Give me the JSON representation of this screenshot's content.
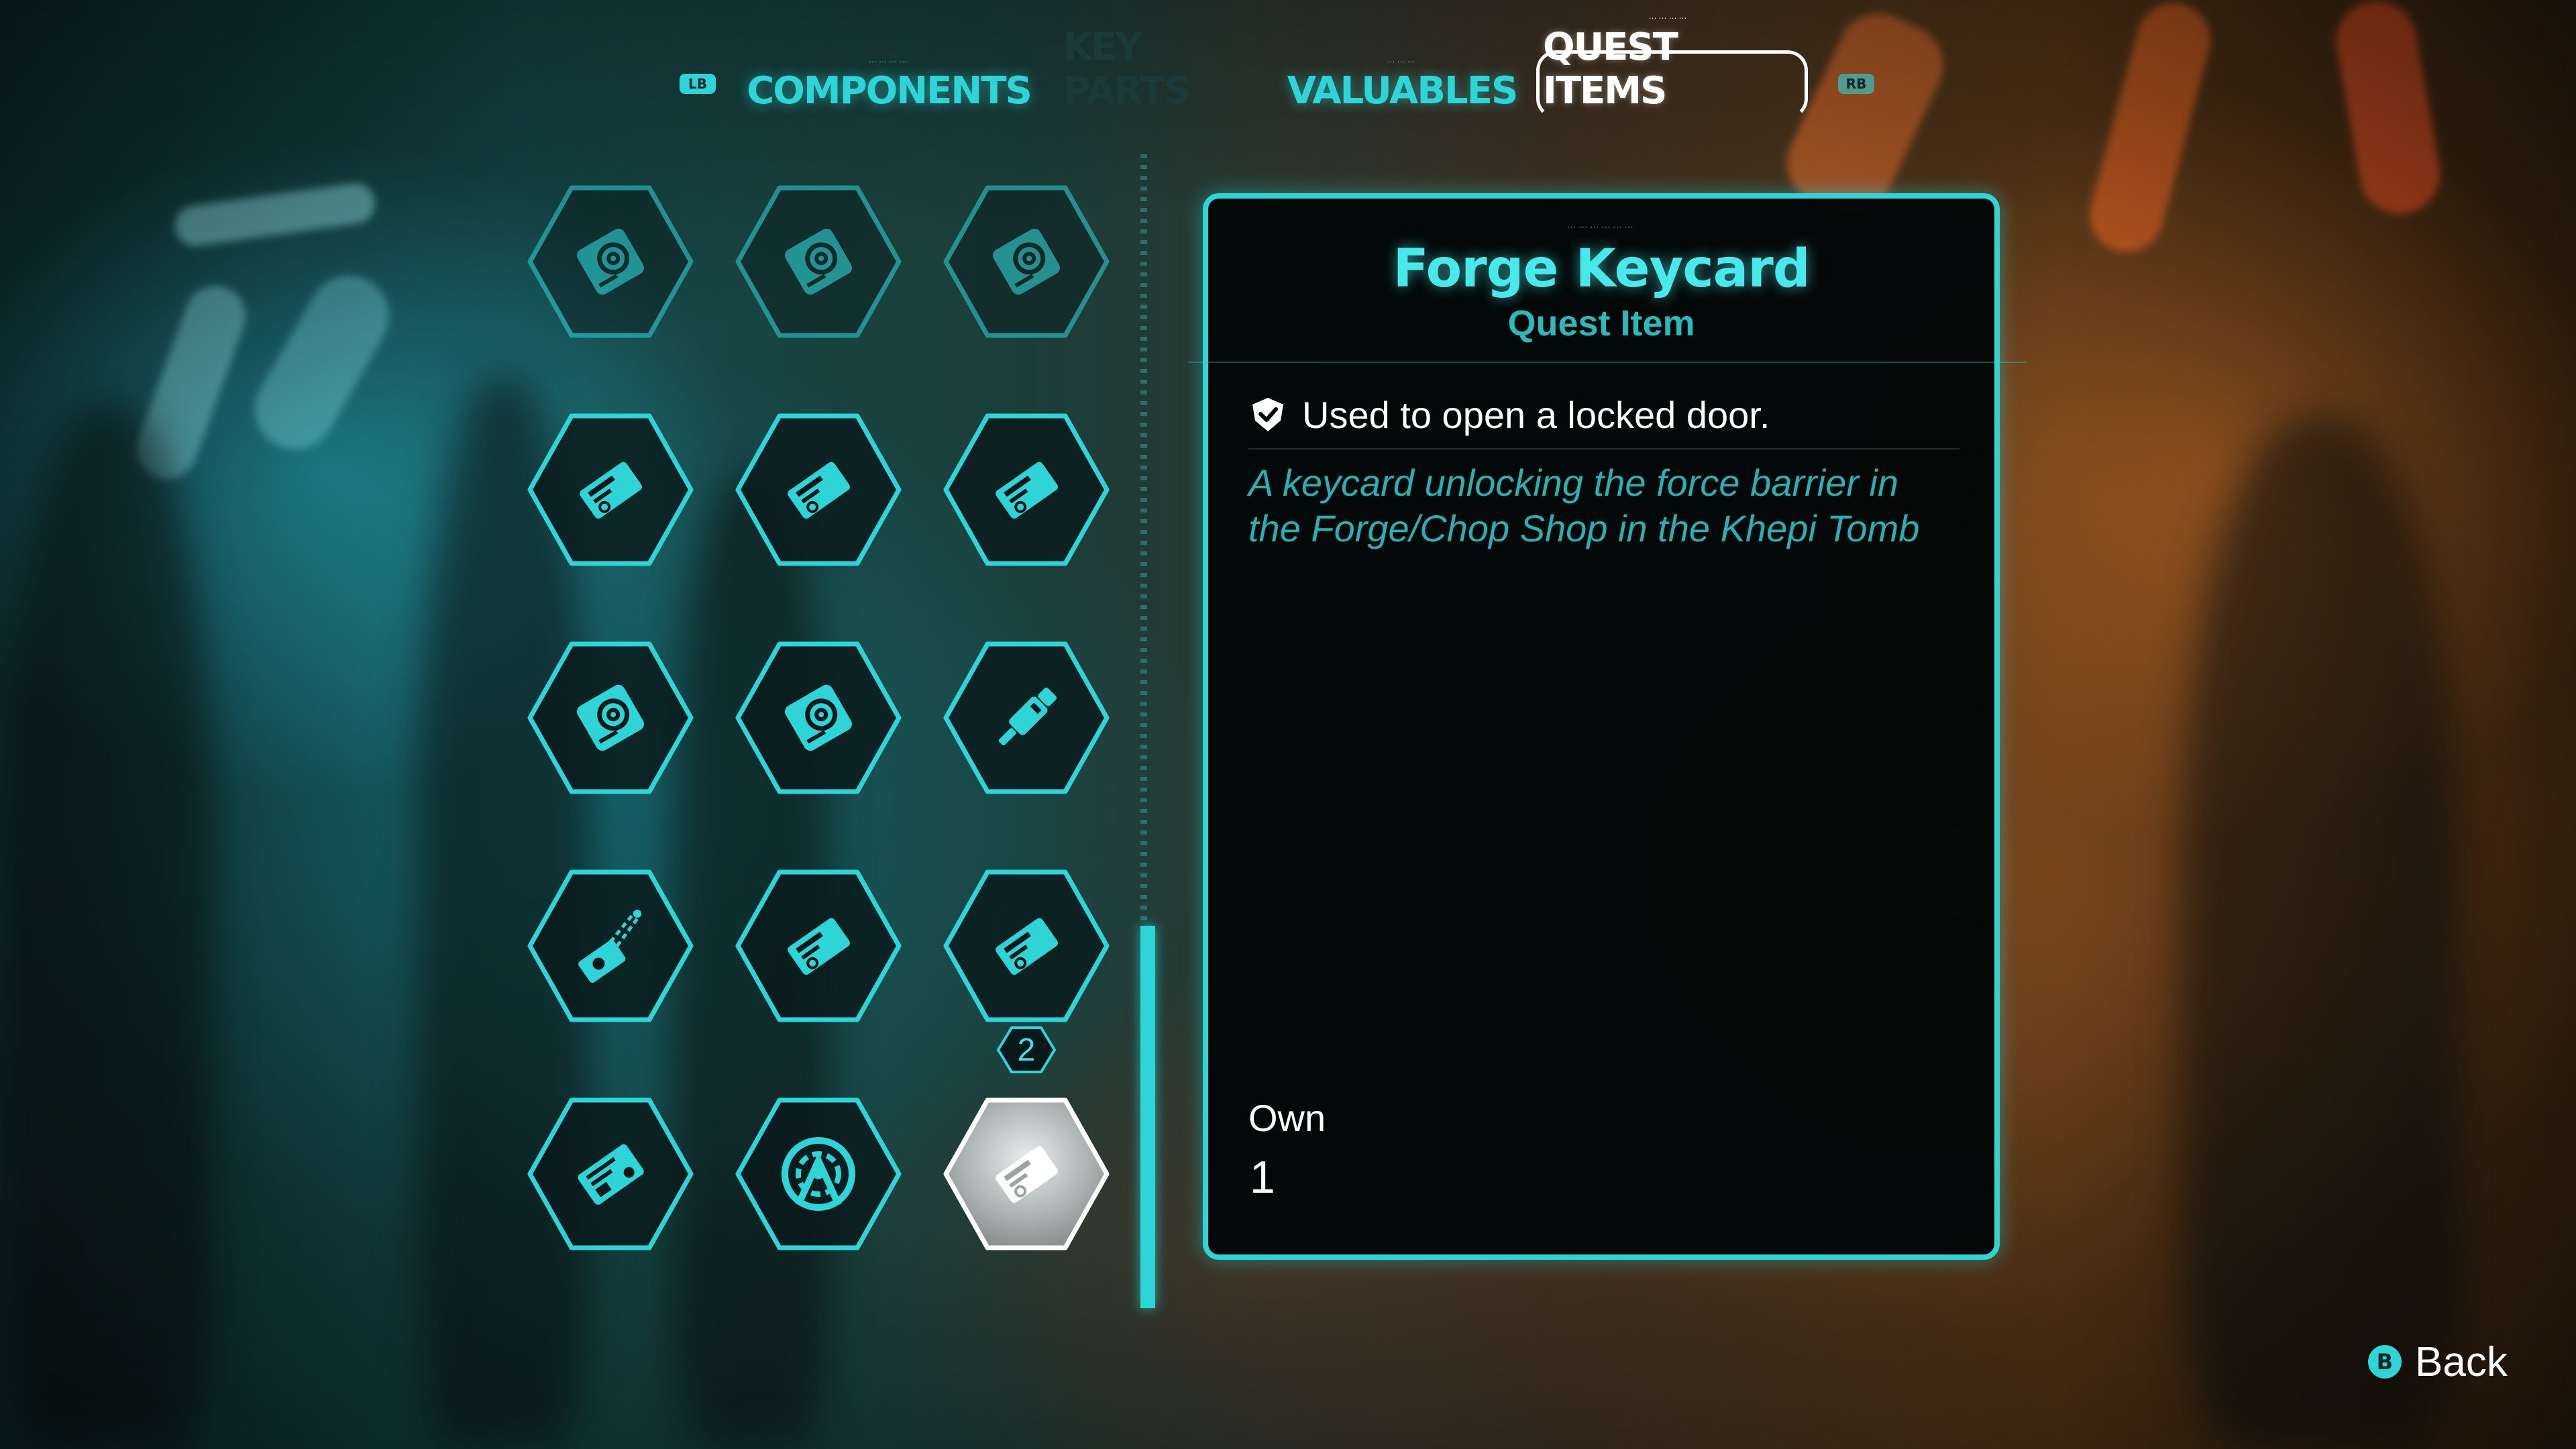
{
  "tabs": {
    "left_bumper": "LB",
    "right_bumper": "RB",
    "items": [
      {
        "label": "COMPONENTS",
        "state": "normal"
      },
      {
        "label": "KEY PARTS",
        "state": "dim"
      },
      {
        "label": "VALUABLES",
        "state": "normal"
      },
      {
        "label": "QUEST ITEMS",
        "state": "active"
      }
    ]
  },
  "grid": {
    "slots": [
      {
        "icon": "hard-drive-icon",
        "state": "faded"
      },
      {
        "icon": "hard-drive-icon",
        "state": "faded"
      },
      {
        "icon": "hard-drive-icon",
        "state": "faded"
      },
      {
        "icon": "keycard-icon",
        "state": "normal"
      },
      {
        "icon": "keycard-icon",
        "state": "normal"
      },
      {
        "icon": "keycard-icon",
        "state": "normal"
      },
      {
        "icon": "hard-drive-icon",
        "state": "normal"
      },
      {
        "icon": "hard-drive-icon",
        "state": "normal"
      },
      {
        "icon": "stim-injector-icon",
        "state": "normal"
      },
      {
        "icon": "scanner-key-icon",
        "state": "normal"
      },
      {
        "icon": "keycard-icon",
        "state": "normal"
      },
      {
        "icon": "keycard-icon",
        "state": "normal",
        "count": "2"
      },
      {
        "icon": "chip-keycard-icon",
        "state": "normal"
      },
      {
        "icon": "emblem-icon",
        "state": "normal"
      },
      {
        "icon": "keycard-icon",
        "state": "selected"
      }
    ]
  },
  "detail": {
    "title": "Forge Keycard",
    "subtitle": "Quest Item",
    "use_text": "Used to open a locked door.",
    "description": "A keycard unlocking the force barrier in the Forge/Chop Shop in the Khepi Tomb",
    "own_label": "Own",
    "own_value": "1"
  },
  "footer": {
    "back_button": "B",
    "back_label": "Back"
  },
  "colors": {
    "accent": "#2fd4d6",
    "selected": "#ffffff",
    "panel_bg": "#020607"
  }
}
